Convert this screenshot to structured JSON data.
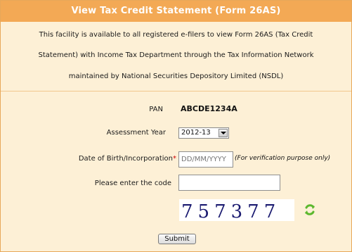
{
  "header": {
    "title": "View Tax Credit Statement (Form 26AS)"
  },
  "intro": {
    "line1": "This facility is available to all registered e-filers to view Form 26AS (Tax Credit",
    "line2": "Statement) with Income Tax Department through the Tax Information Network",
    "line3": "maintained by National Securities Depository Limited (NSDL)"
  },
  "form": {
    "pan_label": "PAN",
    "pan_value": "ABCDE1234A",
    "ay_label": "Assessment Year",
    "ay_value": "2012-13",
    "dob_label": "Date of Birth/Incorporation",
    "dob_required_mark": "*",
    "dob_placeholder": "DD/MM/YYYY",
    "dob_hint": "(For verification purpose only)",
    "code_label": "Please enter the code",
    "code_value": "",
    "captcha_text": "757377",
    "submit_label": "Submit"
  },
  "colors": {
    "header_bg": "#f3a955",
    "panel_bg": "#fdf0d6",
    "border": "#e8a85a",
    "refresh_icon": "#5cb82e"
  },
  "icons": {
    "dropdown": "chevron-down-icon",
    "refresh": "refresh-icon"
  }
}
